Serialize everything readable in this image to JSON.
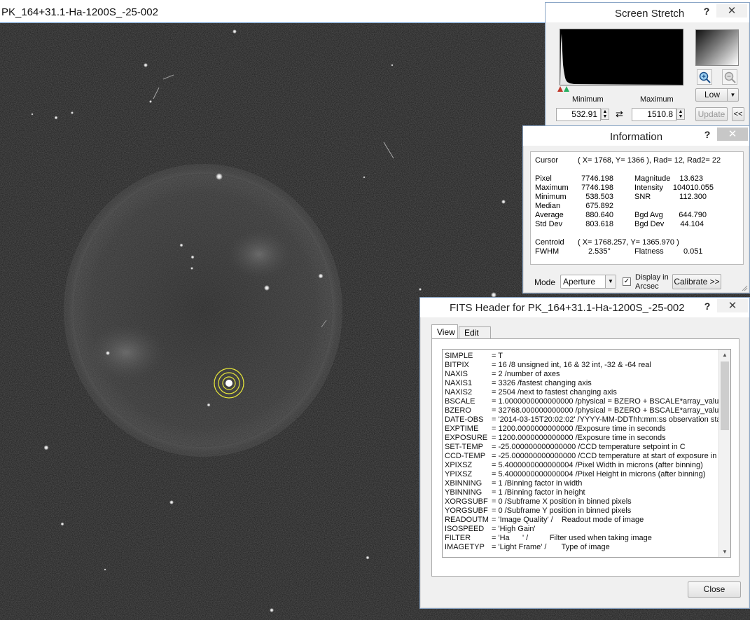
{
  "image_window": {
    "title": "PK_164+31.1-Ha-1200S_-25-002"
  },
  "screen_stretch": {
    "title": "Screen Stretch",
    "help": "?",
    "close": "✕",
    "minimum_label": "Minimum",
    "maximum_label": "Maximum",
    "minimum_value": "532.91",
    "maximum_value": "1510.8",
    "preset_value": "Low",
    "update_label": "Update",
    "collapse_label": "<<"
  },
  "information": {
    "title": "Information",
    "help": "?",
    "close": "✕",
    "cursor_label": "Cursor",
    "cursor_value": "( X= 1768, Y= 1366 ), Rad= 12, Rad2= 22",
    "rows_left": [
      {
        "label": "Pixel",
        "value": "7746.198"
      },
      {
        "label": "Maximum",
        "value": "7746.198"
      },
      {
        "label": "Minimum",
        "value": "538.503"
      },
      {
        "label": "Median",
        "value": "675.892"
      },
      {
        "label": "Average",
        "value": "880.640"
      },
      {
        "label": "Std Dev",
        "value": "803.618"
      }
    ],
    "rows_right": [
      {
        "label": "Magnitude",
        "value": "13.623"
      },
      {
        "label": "Intensity",
        "value": "104010.055"
      },
      {
        "label": "SNR",
        "value": "112.300"
      },
      {
        "label": "Bgd Avg",
        "value": "644.790"
      },
      {
        "label": "Bgd Dev",
        "value": "44.104"
      }
    ],
    "centroid_label": "Centroid",
    "centroid_value": "( X= 1768.257, Y= 1365.970 )",
    "fwhm_label": "FWHM",
    "fwhm_value": "2.535''",
    "flatness_label": "Flatness",
    "flatness_value": "0.051",
    "mode_label": "Mode",
    "mode_value": "Aperture",
    "display_arcsec_label_1": "Display in",
    "display_arcsec_label_2": "Arcsec",
    "display_arcsec_checked": true,
    "calibrate_label": "Calibrate >>"
  },
  "fits_header": {
    "title": "FITS Header for PK_164+31.1-Ha-1200S_-25-002",
    "help": "?",
    "close": "✕",
    "tabs": [
      "View",
      "Edit"
    ],
    "active_tab": "View",
    "close_button": "Close",
    "lines": [
      {
        "key": "SIMPLE",
        "value": "= T"
      },
      {
        "key": "BITPIX",
        "value": "= 16 /8 unsigned int, 16 & 32 int, -32 & -64 real"
      },
      {
        "key": "NAXIS",
        "value": "= 2 /number of axes"
      },
      {
        "key": "NAXIS1",
        "value": "= 3326 /fastest changing axis"
      },
      {
        "key": "NAXIS2",
        "value": "= 2504 /next to fastest changing axis"
      },
      {
        "key": "BSCALE",
        "value": "= 1.0000000000000000 /physical = BZERO + BSCALE*array_value"
      },
      {
        "key": "BZERO",
        "value": "= 32768.000000000000 /physical = BZERO + BSCALE*array_value"
      },
      {
        "key": "DATE-OBS",
        "value": "= '2014-03-15T20:02:02' /YYYY-MM-DDThh:mm:ss observation start"
      },
      {
        "key": "EXPTIME",
        "value": "= 1200.0000000000000 /Exposure time in seconds"
      },
      {
        "key": "EXPOSURE",
        "value": "= 1200.0000000000000 /Exposure time in seconds"
      },
      {
        "key": "SET-TEMP",
        "value": "= -25.000000000000000 /CCD temperature setpoint in C"
      },
      {
        "key": "CCD-TEMP",
        "value": "= -25.000000000000000 /CCD temperature at start of exposure in C"
      },
      {
        "key": "XPIXSZ",
        "value": "= 5.4000000000000004 /Pixel Width in microns (after binning)"
      },
      {
        "key": "YPIXSZ",
        "value": "= 5.4000000000000004 /Pixel Height in microns (after binning)"
      },
      {
        "key": "XBINNING",
        "value": "= 1 /Binning factor in width"
      },
      {
        "key": "YBINNING",
        "value": "= 1 /Binning factor in height"
      },
      {
        "key": "XORGSUBF",
        "value": "= 0 /Subframe X position in binned pixels"
      },
      {
        "key": "YORGSUBF",
        "value": "= 0 /Subframe Y position in binned pixels"
      },
      {
        "key": "READOUTM",
        "value": "= 'Image Quality' /    Readout mode of image"
      },
      {
        "key": "ISOSPEED",
        "value": "= 'High Gain'"
      },
      {
        "key": "FILTER",
        "value": "= 'Ha      ' /          Filter used when taking image"
      },
      {
        "key": "IMAGETYP",
        "value": "= 'Light Frame' /       Type of image"
      }
    ]
  },
  "colors": {
    "aperture_ring": "#e8e83a",
    "histogram_fill": "#ffffff",
    "window_border": "#8ba6c6"
  }
}
